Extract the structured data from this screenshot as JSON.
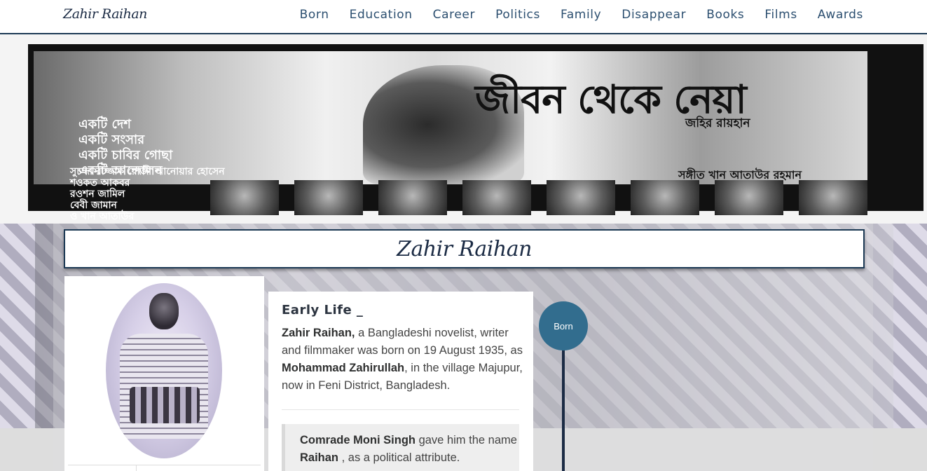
{
  "navbar": {
    "brand": "Zahir Raihan",
    "links": [
      "Born",
      "Education",
      "Career",
      "Politics",
      "Family",
      "Disappear",
      "Books",
      "Films",
      "Awards"
    ]
  },
  "hero": {
    "title": "জীবন থেকে নেয়া",
    "credit": "জহির রায়হান",
    "tagline": "একটি দেশ\nএকটি সংসার\nএকটি চাবির গোছা\nএকটি আন্দোলন",
    "cast": "সুচন্দা রাজ্জাক রোজী আনোয়ার হোসেন\nশওকত আকবর\nরওশন জামিল\nবেবী জামান\nও খান আতাউর",
    "music": "সঙ্গীত খান আতাউর রহমান"
  },
  "page": {
    "title": "Zahir Raihan"
  },
  "early_life": {
    "heading": "Early Life _",
    "name": "Zahir Raihan,",
    "text1": " a Bangladeshi novelist, writer and filmmaker was born on 19 August 1935, as ",
    "birth_name": "Mohammad Zahirullah",
    "text2": ", in the village Majupur, now in Feni District, Bangladesh.",
    "quote_person": "Comrade Moni Singh",
    "quote_text1": " gave him the name ",
    "quote_name": "Raihan",
    "quote_text2": " , as a political attribute."
  },
  "timeline": {
    "label": "Born"
  },
  "colors": {
    "brand": "#1b2b44",
    "nav_link": "#2c4f70",
    "timeline_dot": "#326d8e"
  }
}
